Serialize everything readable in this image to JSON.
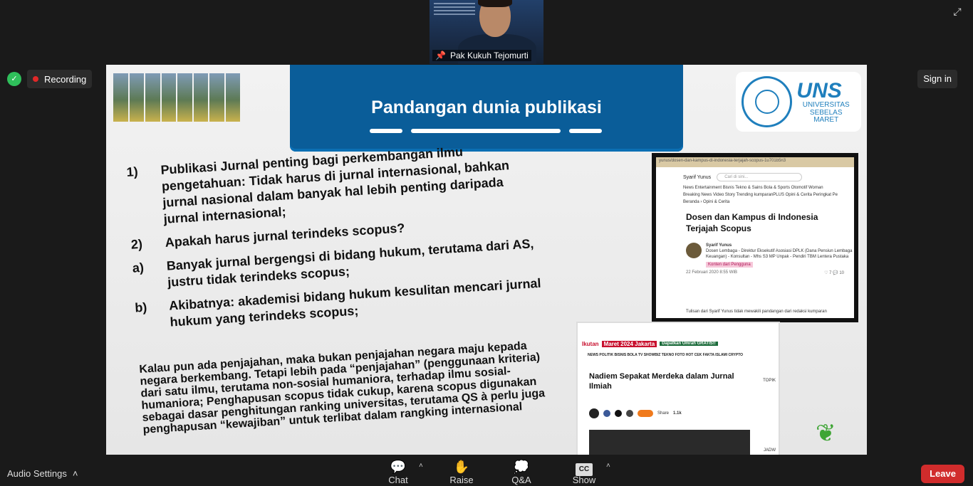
{
  "speaker": {
    "name": "Pak Kukuh Tejomurti",
    "pin_icon": "pin-icon"
  },
  "status": {
    "recording_label": "Recording",
    "sign_in_label": "Sign in"
  },
  "slide": {
    "title": "Pandangan dunia publikasi",
    "logo": {
      "text": "UNS",
      "subtitle_line1": "UNIVERSITAS",
      "subtitle_line2": "SEBELAS MARET"
    },
    "points": [
      {
        "num": "1)",
        "text": "Publikasi Jurnal penting bagi perkembangan ilmu pengetahuan: Tidak harus di jurnal internasional, bahkan jurnal nasional dalam banyak hal lebih penting daripada jurnal internasional;"
      },
      {
        "num": "2)",
        "text": "Apakah harus jurnal terindeks scopus?"
      },
      {
        "num": "a)",
        "text": "Banyak jurnal bergengsi di bidang hukum, terutama dari AS, justru tidak terindeks scopus;"
      },
      {
        "num": "b)",
        "text": "Akibatnya: akademisi bidang hukum kesulitan mencari jurnal hukum yang terindeks scopus;"
      }
    ],
    "paragraph": "Kalau pun ada penjajahan, maka bukan penjajahan negara maju kepada negara berkembang. Tetapi lebih pada “penjajahan” (penggunaan kriteria) dari satu ilmu, terutama non-sosial humaniora, terhadap ilmu sosial-humaniora; Penghapusan scopus tidak cukup, karena scopus digunakan sebagai dasar penghitungan ranking universitas, terutama QS à perlu juga penghapusan “kewajiban” untuk terlibat dalam rangking internasional",
    "article1": {
      "url": "yunus/dosen-dan-kampus-di-indonesia-terjajah-scopus-1u701b5n3",
      "author": "Syarif Yunus",
      "search_placeholder": "Cari di sini...",
      "nav": "News   Entertainment   Bisnis   Tekno & Sains   Bola & Sports   Otomotif   Woman",
      "subnav": "Breaking News   Video Story   Trending   kumparanPLUS   Opini & Cerita   Peringkat Pe",
      "breadcrumb": "Beranda  › Opini & Cerita",
      "title": "Dosen dan Kampus di Indonesia Terjajah Scopus",
      "author_desc": "Dosen Lembaga - Direktur Eksekutif Asosiasi DPLK (Dana Pensiun Lembaga Keuangan) - Konsultan - Mhs S3 MP Unpak - Pendiri TBM Lentera Pustaka",
      "tag": "Konten dari Pengguna",
      "date": "22 Februari 2020 8:55 WIB",
      "likes": "7",
      "comments": "10",
      "footer": "Tulisan dari Syarif Yunus tidak mewakili pandangan dari redaksi kumparan"
    },
    "article2": {
      "ad_ikutan": "Ikutan",
      "ad_event": "Maret 2024 Jakarta",
      "ad_promo": "Dapatkan Umrah GRATIS!!",
      "nav": "NEWS  POLITIK  BISNIS  BOLA  TV  SHOWBIZ  TEKNO  FOTO  HOT  CEK FAKTA  ISLAMI  CRYPTO",
      "title": "Nadiem Sepakat Merdeka dalam Jurnal Ilmiah",
      "share_label": "Share",
      "share_count": "1.1k",
      "side_label": "TOPIK",
      "side_bottom": "JADW"
    }
  },
  "toolbar": {
    "audio_settings": "Audio Settings",
    "chat": "Chat",
    "raise_hand": "Raise Hand",
    "qa": "Q&A",
    "captions": "Show Captions",
    "cc": "CC",
    "leave": "Leave"
  }
}
